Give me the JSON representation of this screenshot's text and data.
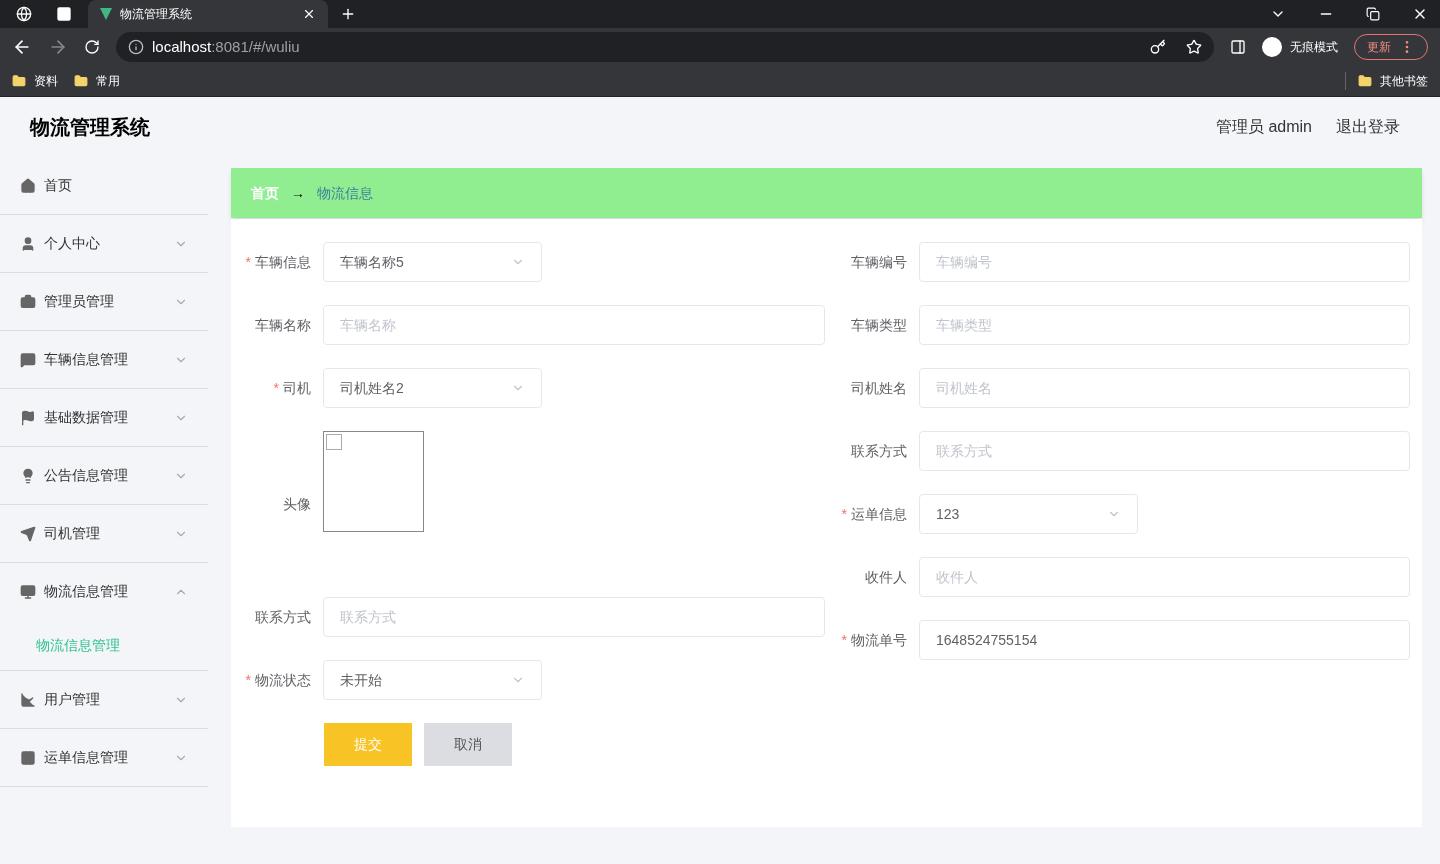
{
  "browser": {
    "tab_title": "物流管理系统",
    "url_host": "localhost",
    "url_path": ":8081/#/wuliu",
    "incognito_label": "无痕模式",
    "update_button": "更新",
    "bookmarks": [
      "资料",
      "常用"
    ],
    "other_bookmarks": "其他书签"
  },
  "header": {
    "title": "物流管理系统",
    "user": "管理员 admin",
    "logout": "退出登录"
  },
  "sidebar": {
    "items": [
      {
        "label": "首页",
        "kind": "link"
      },
      {
        "label": "个人中心",
        "kind": "menu",
        "expanded": false
      },
      {
        "label": "管理员管理",
        "kind": "menu",
        "expanded": false
      },
      {
        "label": "车辆信息管理",
        "kind": "menu",
        "expanded": false
      },
      {
        "label": "基础数据管理",
        "kind": "menu",
        "expanded": false
      },
      {
        "label": "公告信息管理",
        "kind": "menu",
        "expanded": false
      },
      {
        "label": "司机管理",
        "kind": "menu",
        "expanded": false
      },
      {
        "label": "物流信息管理",
        "kind": "menu",
        "expanded": true,
        "children": [
          {
            "label": "物流信息管理",
            "selected": true
          }
        ]
      },
      {
        "label": "用户管理",
        "kind": "menu",
        "expanded": false
      },
      {
        "label": "运单信息管理",
        "kind": "menu",
        "expanded": false
      }
    ]
  },
  "breadcrumb": {
    "home": "首页",
    "separator": "→",
    "current": "物流信息"
  },
  "form": {
    "required_mark": "*",
    "left_fields": [
      {
        "kind": "select",
        "label": "车辆信息",
        "required": true,
        "value": "车辆名称5"
      },
      {
        "kind": "input",
        "label": "车辆名称",
        "required": false,
        "placeholder": "车辆名称"
      },
      {
        "kind": "select",
        "label": "司机",
        "required": true,
        "value": "司机姓名2"
      },
      {
        "kind": "image",
        "label": "头像",
        "required": false
      },
      {
        "kind": "input",
        "label": "联系方式",
        "required": false,
        "placeholder": "联系方式"
      },
      {
        "kind": "select",
        "label": "物流状态",
        "required": true,
        "value": "未开始"
      }
    ],
    "right_fields": [
      {
        "kind": "input",
        "label": "车辆编号",
        "required": false,
        "placeholder": "车辆编号"
      },
      {
        "kind": "input",
        "label": "车辆类型",
        "required": false,
        "placeholder": "车辆类型"
      },
      {
        "kind": "input",
        "label": "司机姓名",
        "required": false,
        "placeholder": "司机姓名"
      },
      {
        "kind": "input",
        "label": "联系方式",
        "required": false,
        "placeholder": "联系方式"
      },
      {
        "kind": "select",
        "label": "运单信息",
        "required": true,
        "value": "123"
      },
      {
        "kind": "input",
        "label": "收件人",
        "required": false,
        "placeholder": "收件人"
      },
      {
        "kind": "input",
        "label": "物流单号",
        "required": true,
        "value": "1648524755154"
      }
    ],
    "buttons": [
      {
        "label": "提交",
        "kind": "primary"
      },
      {
        "label": "取消",
        "kind": "secondary"
      }
    ]
  }
}
